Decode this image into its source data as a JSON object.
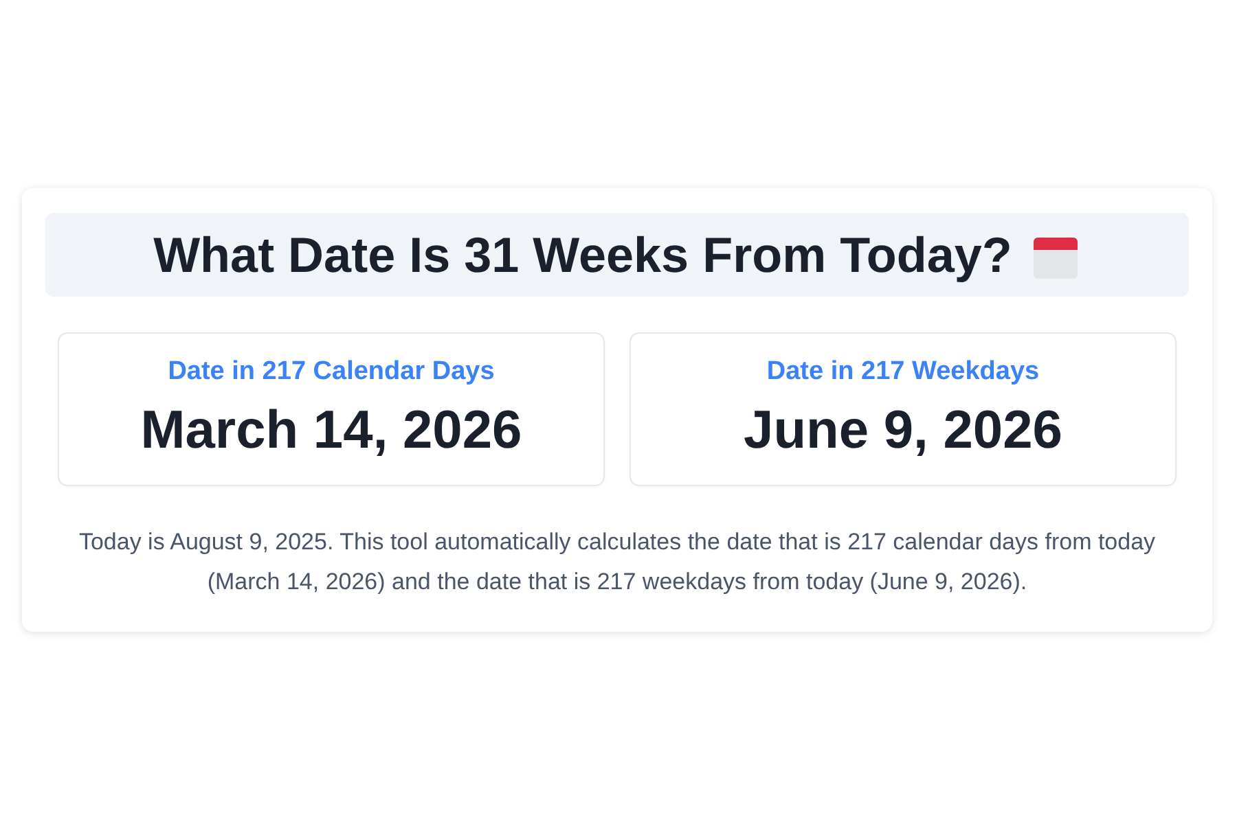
{
  "title": "What Date Is 31 Weeks From Today?",
  "results": [
    {
      "label": "Date in 217 Calendar Days",
      "date": "March 14, 2026"
    },
    {
      "label": "Date in 217 Weekdays",
      "date": "June 9, 2026"
    }
  ],
  "description": "Today is August 9, 2025. This tool automatically calculates the date that is 217 calendar days from today (March 14, 2026) and the date that is 217 weekdays from today (June 9, 2026)."
}
